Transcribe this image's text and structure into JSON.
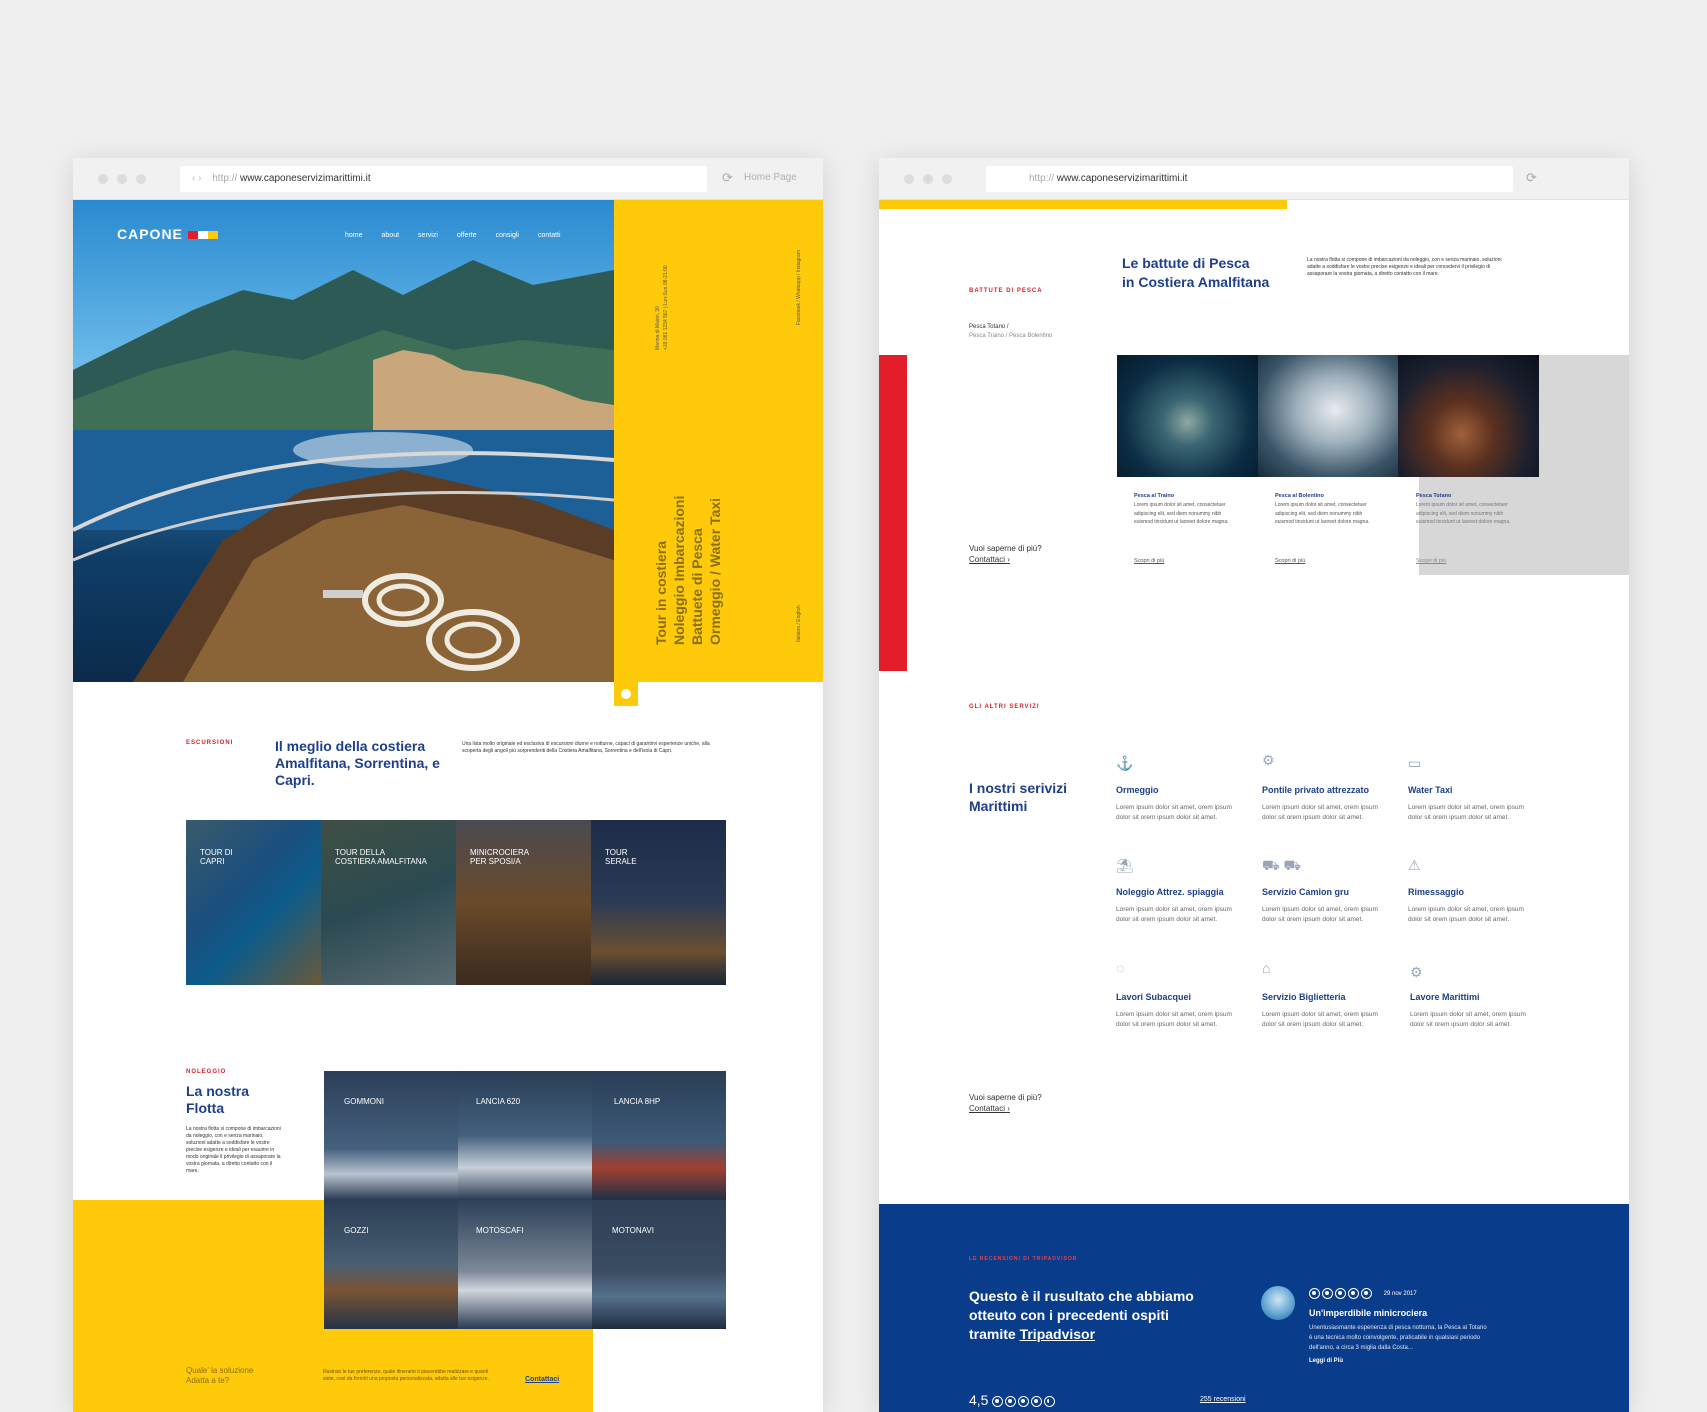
{
  "left_window": {
    "url_proto": "http://",
    "url": "www.caponeservizimarittimi.it",
    "tab_label": "Home Page",
    "logo": "CAPONE",
    "nav": [
      "home",
      "about",
      "servizi",
      "offerte",
      "consigli",
      "contatti"
    ],
    "side_contact": "Marina di Maiori, 30\n+39 081 1234 567 | Lun-Sun 08-21:00",
    "side_social": "Facebook / Whatsapp / Instagram",
    "side_lang": "Italiano / English",
    "hero_taglines": [
      "Tour in costiera",
      "Noleggio Imbarcazioni",
      "Battuete di Pesca",
      "Ormeggio / Water Taxi"
    ],
    "escursioni": {
      "label": "ESCURSIONI",
      "title": "Il meglio della costiera Amalfitana, Sorrentina, e Capri.",
      "desc": "Una lista molto originale ed esclusiva di escursioni diurne e notturne, capaci di garantirvi esperienze uniche, alla scoperta degli angoli più sorprendenti della Costiera Amalfitana, Sorrentina e dell'isola di Capri.",
      "tiles": [
        "TOUR DI\nCAPRI",
        "TOUR DELLA\nCOSTIERA AMALFITANA",
        "MINICROCIERA\nPER SPOSI/A",
        "TOUR\nSERALE"
      ]
    },
    "noleggio": {
      "label": "NOLEGGIO",
      "title": "La nostra Flotta",
      "desc": "La nostra flotta si compone di imbarcazioni da noleggio, con e senza marinaio, soluzioni adatte a soddisfare le vostre precise esigenze e ideali per esaurire in modo originale il privilegio di assaporare la vostra giornata, a diretto contatto con il mare.",
      "boats": [
        "GOMMONI",
        "LANCIA 620",
        "LANCIA 8HP",
        "GOZZI",
        "MOTOSCAFI",
        "MOTONAVI"
      ]
    },
    "footer": {
      "question": "Quale' la soluzione\nAdatta a te?",
      "text": "Illustraci le tue preferenze, quale itinerario ti piacerebbe realizzare e quanti siete, così da fornirti una proposta personalizzata, adatta alle tue esigenze.",
      "cta": "Contattaci"
    }
  },
  "right_window": {
    "url_proto": "http://",
    "url": "www.caponeservizimarittimi.it",
    "pesca": {
      "label": "BATTUTE DI PESCA",
      "title": "Le battute di Pesca\nin Costiera Amalfitana",
      "desc": "La nostra flotta si compone di imbarcazioni da noleggio, con e senza marinaio, soluzioni adatte a soddisfare le vostre precise esigenze e ideali per concedervi il privilegio di assaporare la vostra giornata, a diretto contatto con il mare.",
      "crumb_active": "Pesca Totano",
      "crumb_rest": "Pesca Traino  /  Pesca Bolentino",
      "cards": [
        {
          "title": "Pesca al Traino",
          "desc": "Lorem ipsum dolor sit amet, consectetuer adipiscing elit, sed diem nonummy nibh euismod tincidunt ut laoreet dolore magna.",
          "link": "Scopri di più"
        },
        {
          "title": "Pesca al Bolentino",
          "desc": "Lorem ipsum dolor sit amet, consectetuer adipiscing elit, sed diem nonummy nibh euismod tincidunt ut laoreet dolore magna.",
          "link": "Scopri di più"
        },
        {
          "title": "Pesca Totano",
          "desc": "Lorem ipsum dolor sit amet, consectetuer adipiscing elit, sed diem nonummy nibh euismod tincidunt ut laoreet dolore magna.",
          "link": "Scopri di più"
        }
      ],
      "question": "Vuoi saperne di più?",
      "cta": "Contattaci"
    },
    "servizi": {
      "label": "GLI ALTRI SERVIZI",
      "title": "I nostri serivizi\nMarittimi",
      "lorem": "Lorem ipsum dolor sit amet, orem ipsum dolor sit  orem ipsum dolor sit amet.",
      "items": [
        {
          "title": "Ormeggio",
          "icon": "anchor-icon"
        },
        {
          "title": "Pontile privato attrezzato",
          "icon": "gear-icon"
        },
        {
          "title": "Water Taxi",
          "icon": "taxi-icon"
        },
        {
          "title": "Noleggio Attrez. spiaggia",
          "icon": "umbrella-icon"
        },
        {
          "title": "Servizio Camion gru",
          "icon": "truck-icon"
        },
        {
          "title": "Rimessaggio",
          "icon": "warning-icon"
        },
        {
          "title": "Lavori Subacquei",
          "icon": "diver-icon"
        },
        {
          "title": "Servizio Biglietteria",
          "icon": "ticket-icon"
        },
        {
          "title": "Lavore Marittimi",
          "icon": "cog-icon"
        }
      ],
      "question": "Vuoi saperne di più?",
      "cta": "Contattaci"
    },
    "reviews": {
      "label": "LE RECENSIONI DI TRIPADVISOR",
      "headline_a": "Questo è il rusultato che abbiamo otteuto con i precedenti ospiti tramite ",
      "headline_b": "Tripadvisor",
      "score": "4,5",
      "score_stars": 4.5,
      "count": "255 recensioni",
      "review": {
        "stars": 5,
        "date": "29 nov 2017",
        "title": "Un'imperdibile minicrociera",
        "text": "Unentusiasmante esperienza di pesca notturna, la Pesca al Totano è una tecnica molto coinvolgente, praticabile in qualsiasi periodo dell'anno, a circa 3 miglia dalla Costa...",
        "link": "Leggi di Più"
      }
    }
  },
  "colors": {
    "yellow": "#ffca0a",
    "navy": "#0a3c8c",
    "red": "#e31e2a",
    "blue": "#1e3f8b"
  }
}
